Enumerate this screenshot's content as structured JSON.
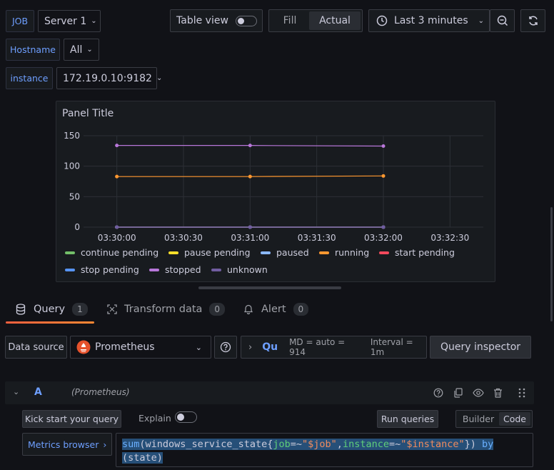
{
  "variables": {
    "job_label": "JOB",
    "job_value": "Server 1",
    "hostname_label": "Hostname",
    "hostname_value": "All",
    "instance_label": "instance",
    "instance_value": "172.19.0.10:9182"
  },
  "toolbar": {
    "table_view_label": "Table view",
    "fill_label": "Fill",
    "actual_label": "Actual",
    "time_range_label": "Last 3 minutes"
  },
  "panel": {
    "title": "Panel Title"
  },
  "chart_data": {
    "type": "line",
    "x": [
      "03:30:00",
      "03:31:00",
      "03:32:00"
    ],
    "x_ticks": [
      "03:30:00",
      "03:30:30",
      "03:31:00",
      "03:31:30",
      "03:32:00",
      "03:32:30"
    ],
    "y_ticks": [
      "0",
      "50",
      "100",
      "150"
    ],
    "ylim": [
      0,
      150
    ],
    "series": [
      {
        "name": "continue pending",
        "color": "#73bf69",
        "values": [
          0,
          0,
          0
        ]
      },
      {
        "name": "pause pending",
        "color": "#fade2a",
        "values": [
          0,
          0,
          0
        ]
      },
      {
        "name": "paused",
        "color": "#8ab8ff",
        "values": [
          0,
          0,
          0
        ]
      },
      {
        "name": "running",
        "color": "#ff9830",
        "values": [
          83,
          83,
          84
        ]
      },
      {
        "name": "start pending",
        "color": "#f2495c",
        "values": [
          0,
          0,
          0
        ]
      },
      {
        "name": "stop pending",
        "color": "#5794f2",
        "values": [
          0,
          0,
          0
        ]
      },
      {
        "name": "stopped",
        "color": "#b877d9",
        "values": [
          134,
          134,
          133
        ]
      },
      {
        "name": "unknown",
        "color": "#705da0",
        "values": [
          0,
          0,
          0
        ]
      }
    ],
    "legend": "bottom"
  },
  "tabs": [
    {
      "label": "Query",
      "count": "1"
    },
    {
      "label": "Transform data",
      "count": "0"
    },
    {
      "label": "Alert",
      "count": "0"
    }
  ],
  "query_bar": {
    "data_source_label": "Data source",
    "data_source_value": "Prometheus",
    "query_options_short": "Qu",
    "md_text": "MD = auto = 914",
    "interval_text": "Interval = 1m",
    "inspector_label": "Query inspector"
  },
  "query_row": {
    "ref_id": "A",
    "datasource_hint": "(Prometheus)",
    "kick_start_label": "Kick start your query",
    "explain_label": "Explain",
    "run_label": "Run queries",
    "builder_label": "Builder",
    "code_label": "Code",
    "metrics_browser_label": "Metrics browser",
    "query_text": "sum(windows_service_state{job=~\"$job\",instance=~\"$instance\"}) by (state)"
  }
}
